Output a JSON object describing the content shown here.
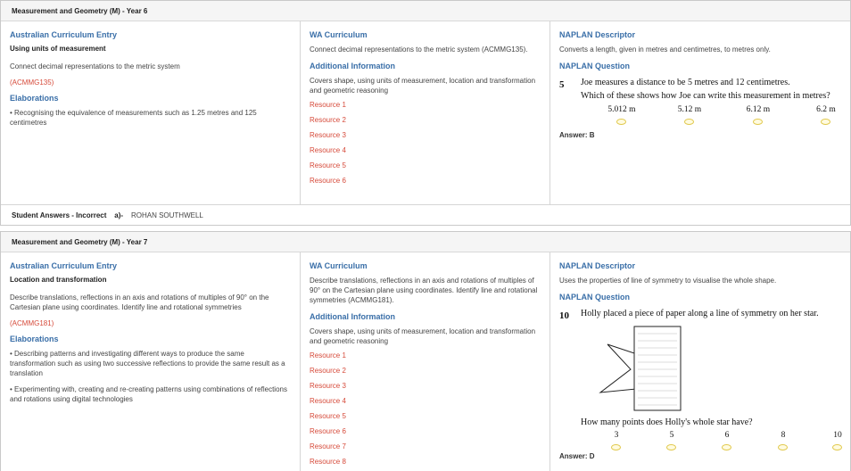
{
  "panel1": {
    "header": "Measurement and Geometry (M) - Year 6",
    "ac": {
      "title": "Australian Curriculum Entry",
      "subtitle": "Using units of measurement",
      "description": "Connect decimal representations to the metric system",
      "code": "(ACMMG135)",
      "elab_title": "Elaborations",
      "elaborations": [
        "• Recognising the equivalence of measurements such as 1.25 metres and 125 centimetres"
      ]
    },
    "wa": {
      "title": "WA Curriculum",
      "description": "Connect decimal representations to the metric system (ACMMG135).",
      "info_title": "Additional Information",
      "info": "Covers shape, using units of measurement, location and transformation and geometric reasoning",
      "resources": [
        "Resource 1",
        "Resource 2",
        "Resource 3",
        "Resource 4",
        "Resource 5",
        "Resource 6"
      ]
    },
    "naplan": {
      "title": "NAPLAN Descriptor",
      "descriptor": "Converts a length, given in metres and centimetres, to metres only.",
      "q_title": "NAPLAN Question",
      "q_number": "5",
      "q_line1": "Joe measures a distance to be 5 metres and 12 centimetres.",
      "q_line2": "Which of these shows how Joe can write this measurement in metres?",
      "options": [
        "5.012 m",
        "5.12 m",
        "6.12 m",
        "6.2 m"
      ],
      "answer": "Answer: B"
    },
    "footer": {
      "label": "Student Answers - Incorrect",
      "item": "a)-",
      "name": "ROHAN SOUTHWELL"
    }
  },
  "panel2": {
    "header": "Measurement and Geometry (M) - Year 7",
    "ac": {
      "title": "Australian Curriculum Entry",
      "subtitle": "Location and transformation",
      "description": "Describe translations, reflections in an axis and rotations of multiples of 90° on the Cartesian plane using coordinates. Identify line and rotational symmetries",
      "code": "(ACMMG181)",
      "elab_title": "Elaborations",
      "elaborations": [
        "• Describing patterns and investigating different ways to produce the same transformation such as using two successive reflections to provide the same result as a translation",
        "• Experimenting with, creating and re-creating patterns using combinations of reflections and rotations using digital technologies"
      ]
    },
    "wa": {
      "title": "WA Curriculum",
      "description": "Describe translations, reflections in an axis and rotations of multiples of 90° on the Cartesian plane using coordinates. Identify line and rotational symmetries (ACMMG181).",
      "info_title": "Additional Information",
      "info": "Covers shape, using units of measurement, location and transformation and geometric reasoning",
      "resources": [
        "Resource 1",
        "Resource 2",
        "Resource 3",
        "Resource 4",
        "Resource 5",
        "Resource 6",
        "Resource 7",
        "Resource 8"
      ]
    },
    "naplan": {
      "title": "NAPLAN Descriptor",
      "descriptor": "Uses the properties of line of symmetry to visualise the whole shape.",
      "q_title": "NAPLAN Question",
      "q_number": "10",
      "q_line1": "Holly placed a piece of paper along a line of symmetry on her star.",
      "q_line2": "How many points does Holly's whole star have?",
      "options": [
        "3",
        "5",
        "6",
        "8",
        "10"
      ],
      "answer": "Answer: D"
    }
  },
  "colors": {
    "accent_blue": "#3a6fa8",
    "link_red": "#d64a3a",
    "bubble_yellow": "#e0c84a"
  }
}
